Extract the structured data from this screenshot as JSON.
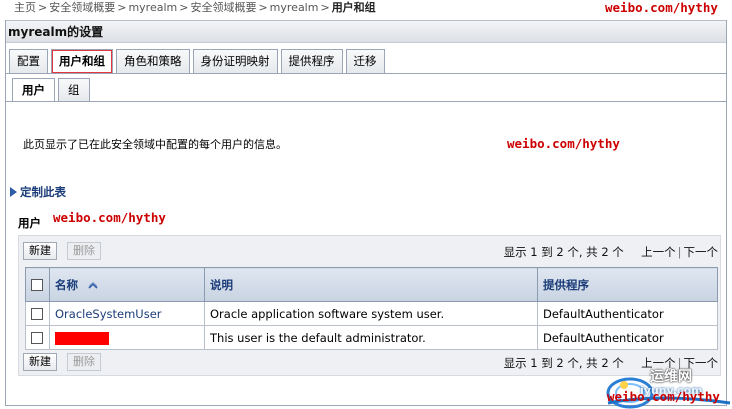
{
  "breadcrumb": {
    "items": [
      "主页",
      "安全领域概要",
      "myrealm",
      "安全领域概要",
      "myrealm"
    ],
    "current": "用户和组"
  },
  "watermark": "weibo.com/hythy",
  "panel": {
    "title": "myrealm的设置",
    "tabs": [
      "配置",
      "用户和组",
      "角色和策略",
      "身份证明映射",
      "提供程序",
      "迁移"
    ],
    "subtabs": [
      "用户",
      "组"
    ]
  },
  "description": "此页显示了已在此安全领域中配置的每个用户的信息。",
  "customize_link": "定制此表",
  "users_caption": "用户",
  "toolbar": {
    "new_label": "新建",
    "delete_label": "删除"
  },
  "pager": {
    "summary": "显示 1 到 2 个, 共 2 个",
    "prev": "上一个",
    "next": "下一个"
  },
  "table": {
    "columns": [
      "名称",
      "说明",
      "提供程序"
    ],
    "rows": [
      {
        "name": "OracleSystemUser",
        "description": "Oracle application software system user.",
        "provider": "DefaultAuthenticator"
      },
      {
        "name": "",
        "description": "This user is the default administrator.",
        "provider": "DefaultAuthenticator"
      }
    ]
  },
  "logo": {
    "text": "运维网",
    "sub": "iyunv.com"
  },
  "colors": {
    "watermark": "#cc0000",
    "link": "#1a3c78",
    "redaction": "#ff0000",
    "active_tab_outline": "#e0383e"
  }
}
